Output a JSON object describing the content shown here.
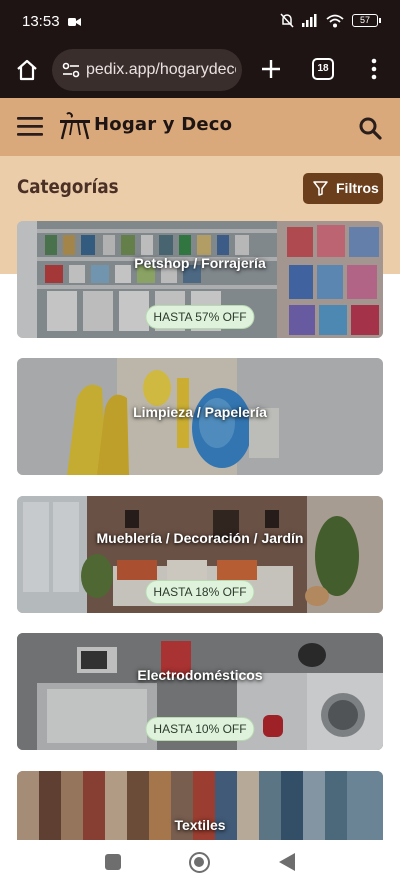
{
  "status_bar": {
    "time": "13:53",
    "battery": "57",
    "icons": [
      "video-record-icon",
      "mute-bell-icon",
      "signal-icon",
      "wifi-icon",
      "battery-icon"
    ]
  },
  "browser": {
    "url": "pedix.app/hogarydeco",
    "tab_count": "18",
    "icons": [
      "home-icon",
      "site-settings-icon",
      "new-tab-icon",
      "tabs-icon",
      "more-vert-icon"
    ]
  },
  "header": {
    "logo_text": "Hogar y Deco",
    "icons": [
      "menu-icon",
      "logo-table-icon",
      "search-icon"
    ],
    "background": "#d9a97c"
  },
  "section": {
    "title": "Categorías",
    "filter_label": "Filtros",
    "band_color": "#eccdaa",
    "filter_color": "#6b3f1c"
  },
  "categories": [
    {
      "title": "Petshop / Forrajería",
      "badge": "HASTA 57% OFF"
    },
    {
      "title": "Limpieza / Papelería",
      "badge": ""
    },
    {
      "title": "Mueblería / Decoración / Jardín",
      "badge": "HASTA 18% OFF"
    },
    {
      "title": "Electrodomésticos",
      "badge": "HASTA 10% OFF"
    },
    {
      "title": "Textiles",
      "badge": ""
    }
  ],
  "nav_bar": {
    "icons": [
      "recents-icon",
      "home-circle-icon",
      "back-icon"
    ]
  }
}
